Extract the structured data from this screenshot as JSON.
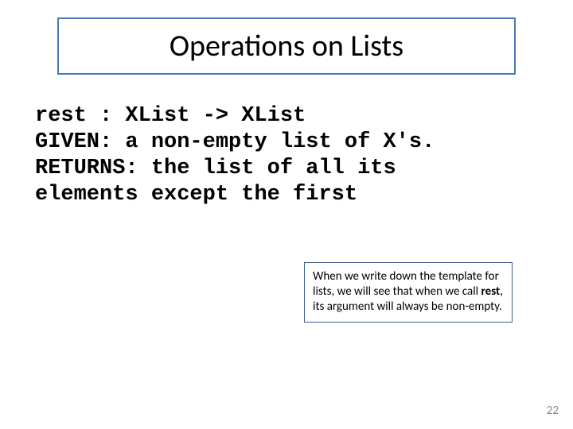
{
  "title": "Operations on Lists",
  "code": {
    "line1": "rest : XList -> XList",
    "line2": "GIVEN: a non-empty list of X's.",
    "line3": "RETURNS: the list of all its",
    "line4": "elements except the first"
  },
  "note": {
    "pre": "When we write down the template for lists, we will see that when we call ",
    "bold": "rest",
    "post": ", its argument will always be non-empty."
  },
  "page_number": "22"
}
